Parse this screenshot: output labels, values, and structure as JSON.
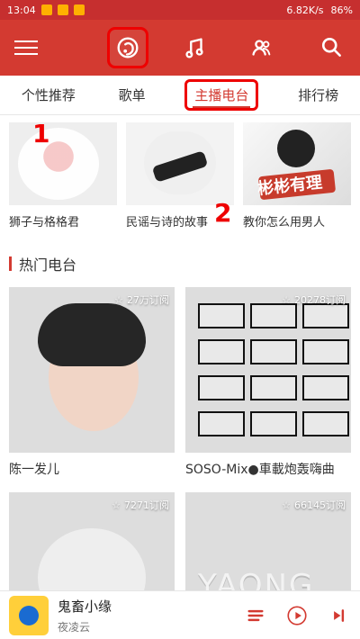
{
  "status": {
    "time": "13:04",
    "speed": "6.82K/s",
    "battery": "86%"
  },
  "topbar": {
    "icons": [
      "music-app-icon",
      "music-note-icon",
      "friends-icon"
    ],
    "search_icon": "search-icon",
    "menu_icon": "menu-icon"
  },
  "tabs": [
    {
      "label": "个性推荐"
    },
    {
      "label": "歌单"
    },
    {
      "label": "主播电台"
    },
    {
      "label": "排行榜"
    }
  ],
  "top_cards": [
    {
      "caption": "狮子与格格君"
    },
    {
      "caption": "民谣与诗的故事"
    },
    {
      "caption": "教你怎么用男人"
    }
  ],
  "top_cards_art": {
    "third_title": "彬彬有理"
  },
  "section": {
    "title": "热门电台"
  },
  "radios": [
    {
      "name": "陈一发儿",
      "subs": "27万订阅"
    },
    {
      "name": "SOSO-Mix●車載炮轰嗨曲",
      "subs": "20278订阅"
    },
    {
      "name": "",
      "subs": "7271订阅"
    },
    {
      "name": "",
      "subs": "66145订阅"
    }
  ],
  "radio_art": {
    "yaong_text": "YAONG"
  },
  "player": {
    "title": "鬼畜小缘",
    "artist": "夜凌云",
    "icons": [
      "playlist-icon",
      "play-icon",
      "next-icon"
    ]
  },
  "annotations": {
    "num1": "1",
    "num2": "2"
  }
}
